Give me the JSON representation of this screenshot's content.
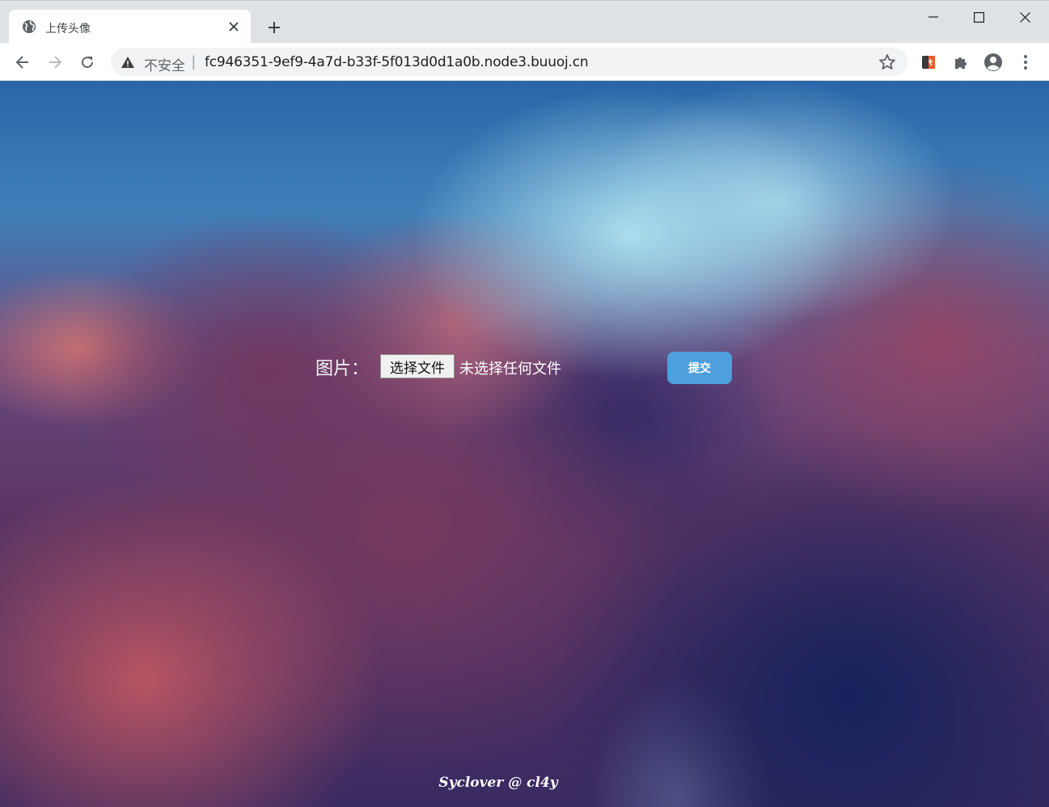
{
  "browser": {
    "tab": {
      "title": "上传头像"
    },
    "address_bar": {
      "security_label": "不安全",
      "separator": "|",
      "url": "fc946351-9ef9-4a7d-b33f-5f013d0d1a0b.node3.buuoj.cn"
    },
    "icons": {
      "favicon": "globe-icon",
      "tab_close": "close-icon",
      "new_tab": "plus-icon",
      "minimize": "minimize-icon",
      "maximize": "maximize-icon",
      "window_close": "close-icon",
      "back": "back-arrow-icon",
      "forward": "forward-arrow-icon",
      "reload": "reload-icon",
      "security": "warning-icon",
      "bookmark": "star-icon",
      "extension": "extension-icon",
      "extensions_menu": "puzzle-icon",
      "profile": "account-icon",
      "menu": "kebab-menu-icon"
    }
  },
  "page": {
    "form": {
      "label": "图片：",
      "file_button": "选择文件",
      "file_status": "未选择任何文件",
      "submit": "提交"
    },
    "footer": "Syclover @ cl4y"
  },
  "colors": {
    "tabstrip": "#dee1e6",
    "submit_button": "#4ea0dc",
    "text_on_page": "#ffffff"
  }
}
